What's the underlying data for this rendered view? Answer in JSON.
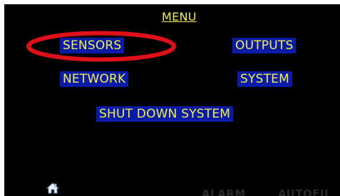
{
  "menu": {
    "title": "MENU",
    "buttons": {
      "sensors": "SENSORS",
      "outputs": "OUTPUTS",
      "network": "NETWORK",
      "system": "SYSTEM",
      "shutdown": "SHUT DOWN SYSTEM"
    }
  },
  "footer": {
    "home_icon": "home-icon",
    "alarm": "ALARM",
    "autofill": "AUTOFIL"
  },
  "annotation": {
    "highlight_color": "#e0101a",
    "highlight_target": "sensors"
  },
  "colors": {
    "background": "#000000",
    "button_bg": "#0c1aa8",
    "button_text": "#f0f04a",
    "title_text": "#f2f24a",
    "footer_text": "#2a2a2a"
  }
}
